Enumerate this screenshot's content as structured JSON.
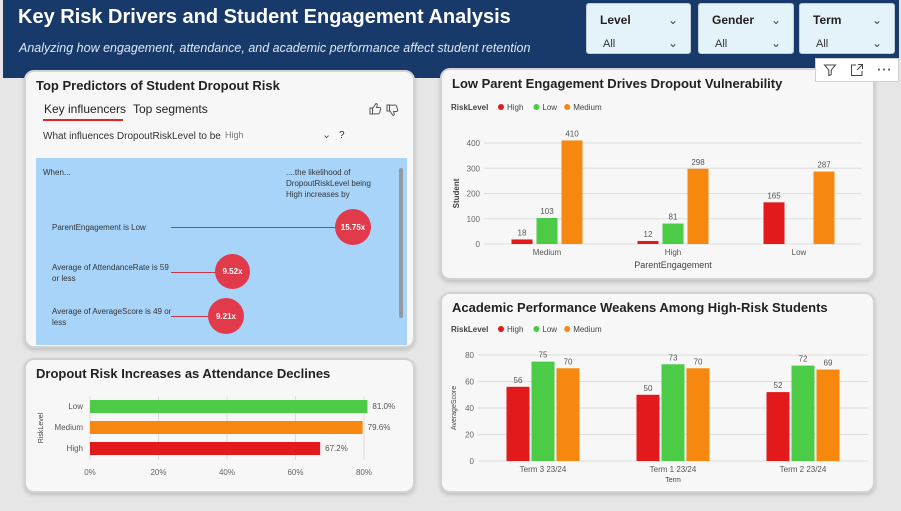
{
  "header": {
    "title": "Key Risk Drivers and Student Engagement Analysis",
    "subtitle": "Analyzing how engagement, attendance, and academic performance affect student retention"
  },
  "slicers": [
    {
      "label": "Level",
      "value": "All"
    },
    {
      "label": "Gender",
      "value": "All"
    },
    {
      "label": "Term",
      "value": "All"
    }
  ],
  "visual_toolbar": {
    "icons": [
      "filter-icon",
      "focus-mode-icon",
      "more-options-icon"
    ],
    "more_glyph": "⋯"
  },
  "key_influencers": {
    "title": "Top Predictors of Student Dropout Risk",
    "tabs": [
      "Key influencers",
      "Top segments"
    ],
    "active_tab": "Key influencers",
    "question": "What influences DropoutRiskLevel to be",
    "question_value": "High",
    "question_mark": "?",
    "col_when": "When...",
    "col_likelihood": "....the likelihood of DropoutRiskLevel being High increases by",
    "factors": [
      {
        "label": "ParentEngagement is Low",
        "value": "15.75x"
      },
      {
        "label": "Average of AttendanceRate is 59 or less",
        "value": "9.52x"
      },
      {
        "label": "Average of AverageScore is 49 or less",
        "value": "9.21x"
      }
    ]
  },
  "colors": {
    "high": "#e31a1c",
    "low": "#4ccc46",
    "medium": "#f7880f",
    "header": "#183a6b",
    "bubble": "#e03a4b"
  },
  "attendance_chart": {
    "title": "Dropout Risk Increases as Attendance Declines",
    "chart_data": {
      "type": "bar",
      "orientation": "horizontal",
      "categories": [
        "Low",
        "Medium",
        "High"
      ],
      "values": [
        81.0,
        79.6,
        67.2
      ],
      "value_labels": [
        "81.0%",
        "79.6%",
        "67.2%"
      ],
      "colors": [
        "#4ccc46",
        "#f7880f",
        "#e31a1c"
      ],
      "xlabel": "",
      "ylabel": "RiskLevel",
      "xlim": [
        0,
        80
      ],
      "x_ticks": [
        "0%",
        "20%",
        "40%",
        "60%",
        "80%"
      ],
      "grid": true
    }
  },
  "parent_chart": {
    "title": "Low Parent Engagement Drives Dropout Vulnerability",
    "legend_title": "RiskLevel",
    "chart_data": {
      "type": "bar",
      "categories": [
        "Medium",
        "High",
        "Low"
      ],
      "series": [
        {
          "name": "High",
          "values": [
            18,
            12,
            165
          ]
        },
        {
          "name": "Low",
          "values": [
            103,
            81,
            null
          ]
        },
        {
          "name": "Medium",
          "values": [
            410,
            298,
            287
          ]
        }
      ],
      "xlabel": "ParentEngagement",
      "ylabel": "Student",
      "ylim": [
        0,
        400
      ],
      "y_ticks": [
        0,
        100,
        200,
        300,
        400
      ],
      "legend": "top-left",
      "grid": true
    }
  },
  "academic_chart": {
    "title": "Academic Performance Weakens Among High-Risk Students",
    "legend_title": "RiskLevel",
    "chart_data": {
      "type": "bar",
      "categories": [
        "Term 3 23/24",
        "Term 1 23/24",
        "Term 2 23/24"
      ],
      "series": [
        {
          "name": "High",
          "values": [
            56,
            50,
            52
          ]
        },
        {
          "name": "Low",
          "values": [
            75,
            73,
            72
          ]
        },
        {
          "name": "Medium",
          "values": [
            70,
            70,
            69
          ]
        }
      ],
      "xlabel": "Term",
      "ylabel": "AverageScore",
      "ylim": [
        0,
        80
      ],
      "y_ticks": [
        0,
        20,
        40,
        60,
        80
      ],
      "legend": "top-left",
      "grid": true
    }
  }
}
